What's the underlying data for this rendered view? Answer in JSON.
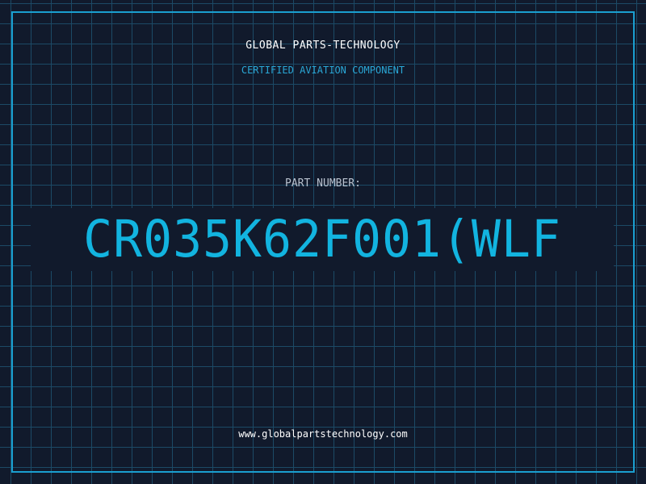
{
  "header": {
    "company": "GLOBAL PARTS-TECHNOLOGY",
    "tagline": "CERTIFIED AVIATION COMPONENT"
  },
  "part": {
    "label": "PART NUMBER:",
    "number": "CR035K62F001(WLF"
  },
  "footer": {
    "url": "www.globalpartstechnology.com"
  },
  "colors": {
    "background": "#111a2c",
    "grid": "#1c4a66",
    "accent": "#12b4e0",
    "frame": "#1a9fd0"
  }
}
